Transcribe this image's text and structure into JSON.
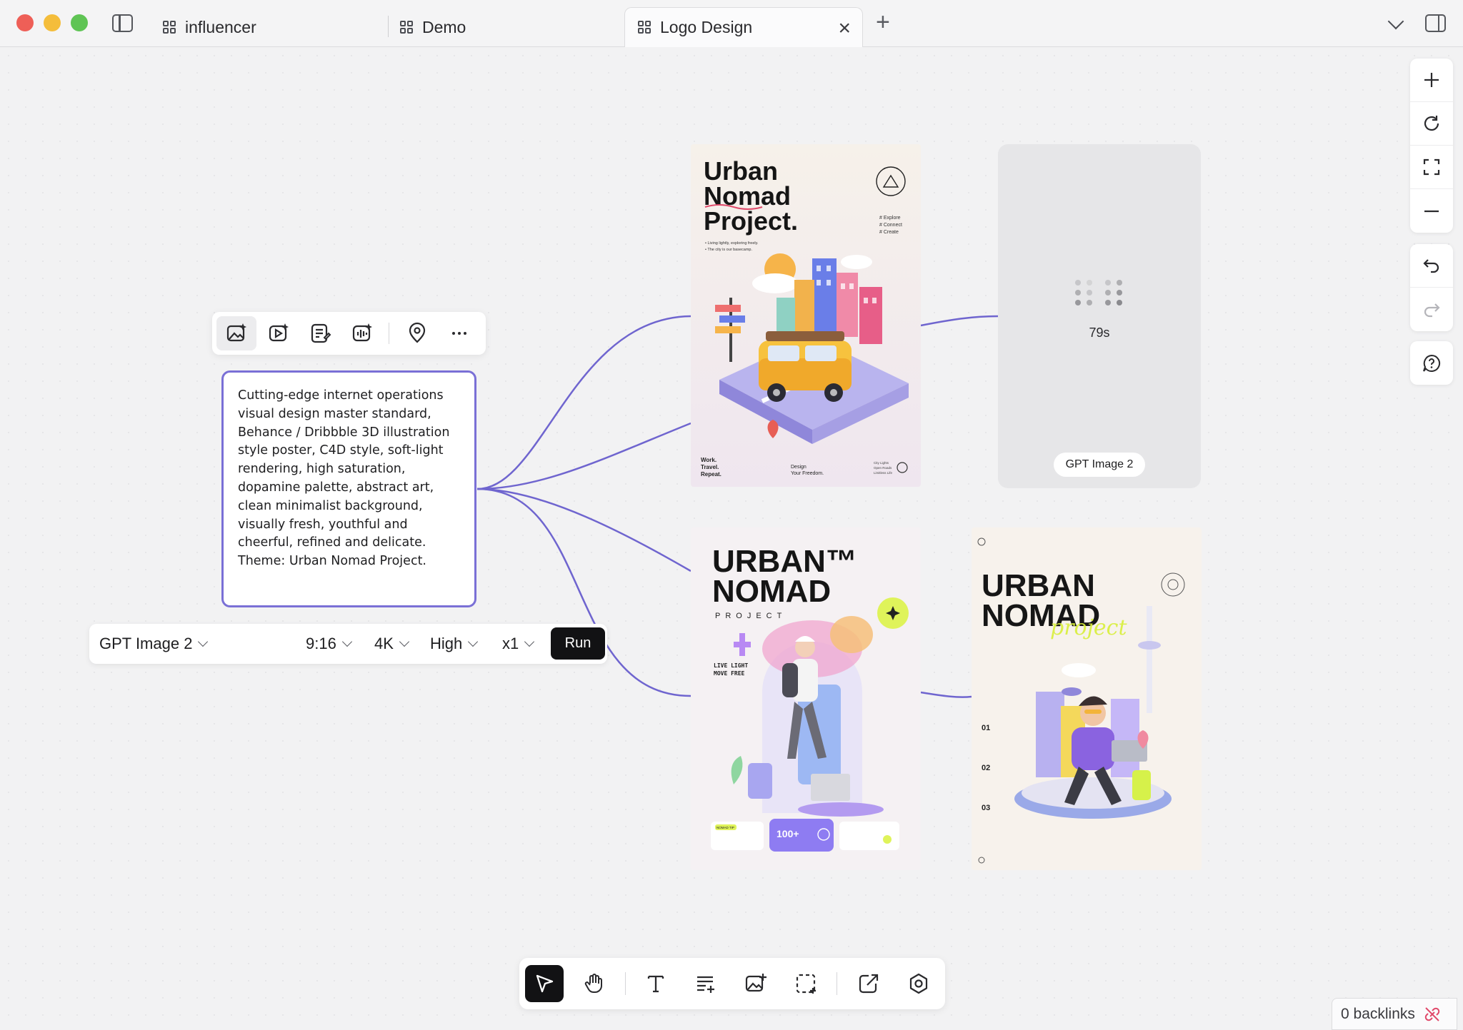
{
  "tabs": [
    {
      "label": "influencer"
    },
    {
      "label": "Demo"
    },
    {
      "label": "Logo Design"
    }
  ],
  "node_toolbar": {
    "buttons": [
      "image-generate",
      "video-generate",
      "text-edit",
      "audio-generate",
      "location",
      "more"
    ]
  },
  "prompt": {
    "text": "Cutting-edge internet operations visual design master standard, Behance / Dribbble 3D illustration style poster, C4D style, soft-light rendering, high saturation, dopamine palette, abstract art, clean minimalist background, visually fresh, youthful and cheerful, refined and delicate. Theme: Urban Nomad Project."
  },
  "gen_bar": {
    "model": "GPT Image 2",
    "ratio": "9:16",
    "resolution": "4K",
    "quality": "High",
    "count": "x1",
    "run_label": "Run"
  },
  "posters": {
    "a": {
      "title_lines": [
        "Urban",
        "Nomad",
        "Project."
      ],
      "tags": [
        "# Explore",
        "# Connect",
        "# Create"
      ],
      "bullets": [
        "• Living lightly, exploring freely.",
        "• The city is our basecamp."
      ],
      "footer_left": [
        "Work.",
        "Travel.",
        "Repeat."
      ],
      "footer_mid": [
        "Design",
        "Your Freedom."
      ],
      "footer_right": [
        "City Lights",
        "Open Roads",
        "Limitless Life"
      ]
    },
    "c": {
      "title_lines": [
        "URBAN™",
        "NOMAD"
      ],
      "subtitle": "PROJECT",
      "side_text": [
        "LIVE LIGHT",
        "MOVE FREE"
      ],
      "stat": "100+",
      "tip_label": "NOMAD TIP"
    },
    "d": {
      "title_lines": [
        "URBAN",
        "NOMAD"
      ],
      "script": "project",
      "numbers": [
        "01",
        "02",
        "03"
      ]
    }
  },
  "loading_card": {
    "time": "79s",
    "model": "GPT Image 2"
  },
  "backlinks": {
    "label": "0 backlinks"
  },
  "colors": {
    "accent": "#7a70d6",
    "run_button": "#121214"
  }
}
